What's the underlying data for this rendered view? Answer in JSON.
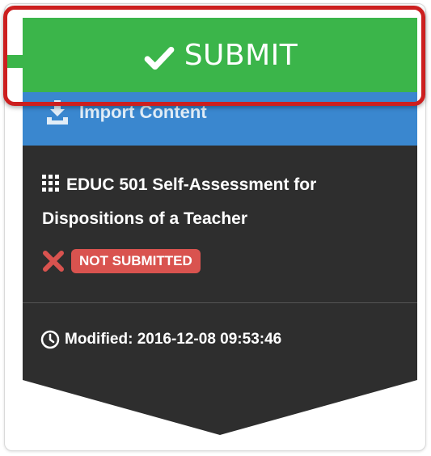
{
  "submit": {
    "label": "SUBMIT",
    "icon": "check-icon",
    "color": "#3bb54a"
  },
  "import": {
    "label": "Import Content",
    "icon": "import-icon",
    "color": "#3a87cf"
  },
  "assignment": {
    "title": "EDUC 501 Self-Assessment for Dispositions of a Teacher",
    "icon": "grid-icon",
    "status_icon": "x-icon",
    "status_label": "NOT SUBMITTED",
    "status_color": "#d9534f"
  },
  "meta": {
    "modified_label": "Modified: 2016-12-08 09:53:46",
    "icon": "clock-icon"
  },
  "highlight": {
    "color": "#cc1f1f"
  }
}
